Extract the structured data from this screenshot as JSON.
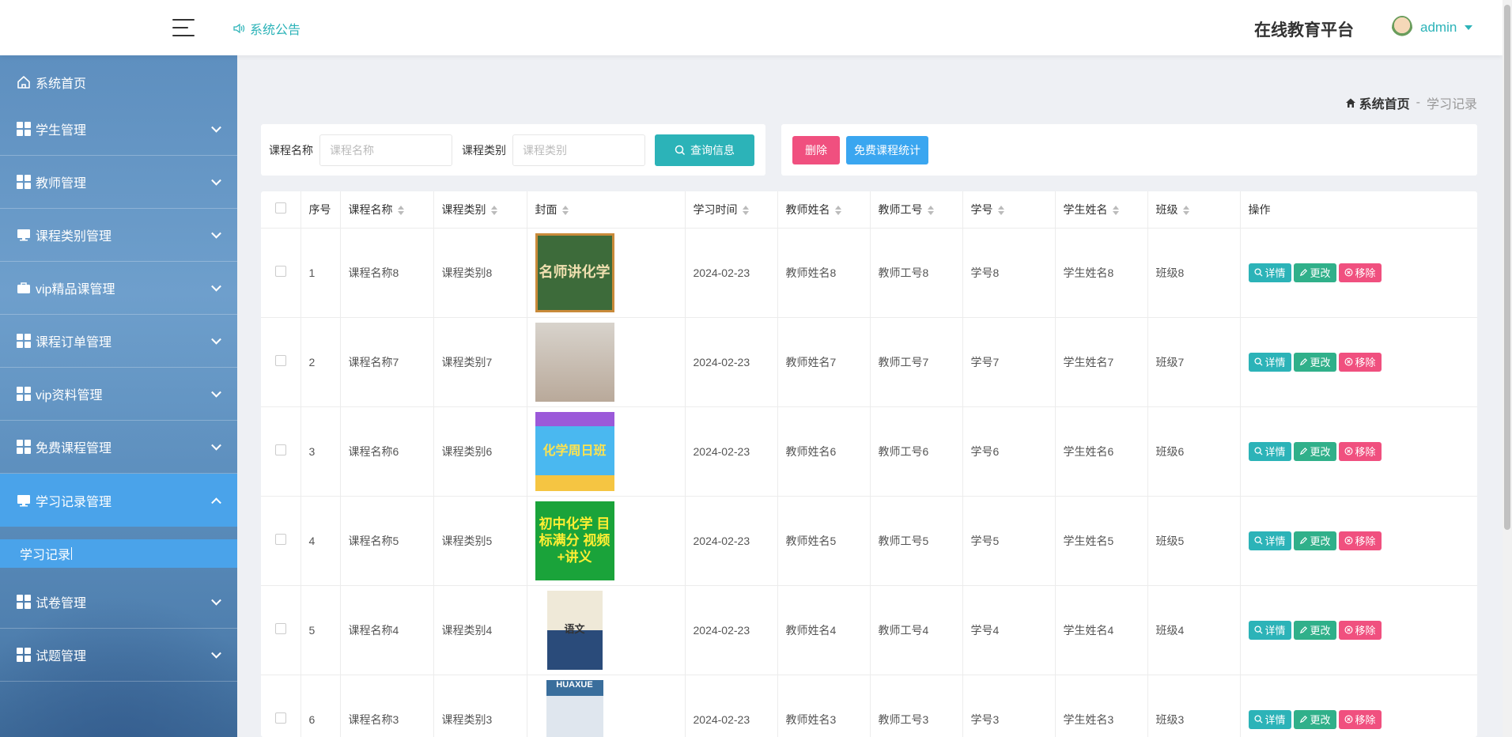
{
  "header": {
    "notice_label": "系统公告",
    "brand": "在线教育平台",
    "username": "admin"
  },
  "sidebar": {
    "home": "系统首页",
    "items": [
      {
        "label": "学生管理",
        "icon": "grid-icon"
      },
      {
        "label": "教师管理",
        "icon": "grid-icon"
      },
      {
        "label": "课程类别管理",
        "icon": "monitor-icon"
      },
      {
        "label": "vip精品课管理",
        "icon": "briefcase-icon"
      },
      {
        "label": "课程订单管理",
        "icon": "grid-icon"
      },
      {
        "label": "vip资料管理",
        "icon": "grid-icon"
      },
      {
        "label": "免费课程管理",
        "icon": "grid-icon"
      },
      {
        "label": "学习记录管理",
        "icon": "monitor-icon",
        "expanded": true
      },
      {
        "label": "试卷管理",
        "icon": "grid-icon"
      },
      {
        "label": "试题管理",
        "icon": "grid-icon"
      }
    ],
    "active_sub": "学习记录",
    "active_color": "#4aa3ea"
  },
  "breadcrumb": {
    "home": "系统首页",
    "separator": "-",
    "current": "学习记录"
  },
  "search": {
    "course_name_label": "课程名称",
    "course_name_placeholder": "课程名称",
    "course_type_label": "课程类别",
    "course_type_placeholder": "课程类别",
    "button": "查询信息"
  },
  "actions": {
    "delete": "删除",
    "stats": "免费课程统计"
  },
  "table": {
    "columns": [
      "序号",
      "课程名称",
      "课程类别",
      "封面",
      "学习时间",
      "教师姓名",
      "教师工号",
      "学号",
      "学生姓名",
      "班级",
      "操作"
    ],
    "op_labels": {
      "detail": "详情",
      "edit": "更改",
      "remove": "移除"
    },
    "rows": [
      {
        "no": "1",
        "course": "课程名称8",
        "type": "课程类别8",
        "cover_text": "名师讲化学",
        "time": "2024-02-23",
        "teacher": "教师姓名8",
        "teacher_no": "教师工号8",
        "student_no": "学号8",
        "student": "学生姓名8",
        "class": "班级8"
      },
      {
        "no": "2",
        "course": "课程名称7",
        "type": "课程类别7",
        "cover_text": "",
        "time": "2024-02-23",
        "teacher": "教师姓名7",
        "teacher_no": "教师工号7",
        "student_no": "学号7",
        "student": "学生姓名7",
        "class": "班级7"
      },
      {
        "no": "3",
        "course": "课程名称6",
        "type": "课程类别6",
        "cover_text": "化学周日班",
        "time": "2024-02-23",
        "teacher": "教师姓名6",
        "teacher_no": "教师工号6",
        "student_no": "学号6",
        "student": "学生姓名6",
        "class": "班级6"
      },
      {
        "no": "4",
        "course": "课程名称5",
        "type": "课程类别5",
        "cover_text": "初中化学 目标满分 视频+讲义",
        "time": "2024-02-23",
        "teacher": "教师姓名5",
        "teacher_no": "教师工号5",
        "student_no": "学号5",
        "student": "学生姓名5",
        "class": "班级5"
      },
      {
        "no": "5",
        "course": "课程名称4",
        "type": "课程类别4",
        "cover_text": "语文",
        "time": "2024-02-23",
        "teacher": "教师姓名4",
        "teacher_no": "教师工号4",
        "student_no": "学号4",
        "student": "学生姓名4",
        "class": "班级4"
      },
      {
        "no": "6",
        "course": "课程名称3",
        "type": "课程类别3",
        "cover_text": "HUAXUE",
        "time": "2024-02-23",
        "teacher": "教师姓名3",
        "teacher_no": "教师工号3",
        "student_no": "学号3",
        "student": "学生姓名3",
        "class": "班级3"
      }
    ]
  },
  "colors": {
    "accent": "#2cb3b8",
    "danger": "#f0507f",
    "info": "#3aa6f0",
    "success": "#30b08a"
  }
}
